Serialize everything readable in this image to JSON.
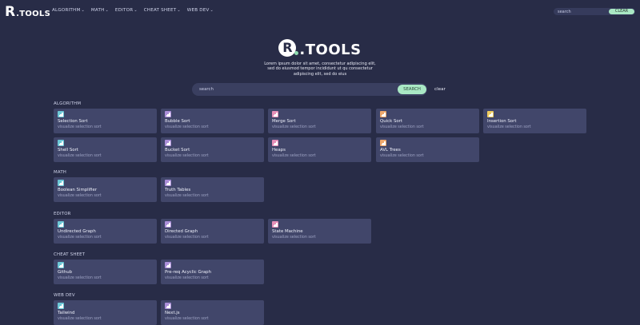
{
  "brand": {
    "logo_letter": "R",
    "logo_text": ".TOOLS"
  },
  "nav": {
    "items": [
      {
        "label": "ALGORITHM"
      },
      {
        "label": "MATH"
      },
      {
        "label": "EDITOR"
      },
      {
        "label": "CHEAT SHEET"
      },
      {
        "label": "WEB DEV"
      }
    ],
    "caret": "⌄",
    "search_placeholder": "search",
    "clear_label": "CLEAR"
  },
  "hero": {
    "description": "Lorem ipsum dolor sit amet, consectetur adipiscing elit, sed do eiusmod tempor incididunt ut qu consectetur adipiscing elit, sed do eius",
    "search_placeholder": "search",
    "search_button": "SEARCH",
    "clear_link": "clear"
  },
  "colors": {
    "background": "#282c47",
    "card": "#41466a",
    "accent": "#a9e8c4",
    "icon_teal": "#6cc7d6",
    "icon_pink": "#e58fb8",
    "icon_orange": "#eea76b",
    "icon_yellow": "#eecb5e",
    "icon_purple": "#ab8fd9"
  },
  "sections": [
    {
      "title": "ALGORITHM",
      "cards": [
        {
          "title": "Selection Sort",
          "subtitle": "visualize selection sort",
          "icon": "chart-bars-icon",
          "icon_color": "#6cc7d6"
        },
        {
          "title": "Bubble Sort",
          "subtitle": "visualize selection sort",
          "icon": "chart-bars-icon",
          "icon_color": "#ab8fd9"
        },
        {
          "title": "Merge Sort",
          "subtitle": "visualize selection sort",
          "icon": "chart-bars-icon",
          "icon_color": "#e58fb8"
        },
        {
          "title": "Quick Sort",
          "subtitle": "visualize selection sort",
          "icon": "chart-bars-icon",
          "icon_color": "#eea76b"
        },
        {
          "title": "Insertion Sort",
          "subtitle": "visualize selection sort",
          "icon": "chart-bars-icon",
          "icon_color": "#eecb5e"
        },
        {
          "title": "Shell Sort",
          "subtitle": "visualize selection sort",
          "icon": "chart-bars-icon",
          "icon_color": "#6cc7d6"
        },
        {
          "title": "Bucket Sort",
          "subtitle": "visualize selection sort",
          "icon": "chart-bars-icon",
          "icon_color": "#ab8fd9"
        },
        {
          "title": "Heaps",
          "subtitle": "visualize selection sort",
          "icon": "chart-bars-icon",
          "icon_color": "#e58fb8"
        },
        {
          "title": "AVL Trees",
          "subtitle": "visualize selection sort",
          "icon": "chart-bars-icon",
          "icon_color": "#eea76b"
        }
      ]
    },
    {
      "title": "MATH",
      "cards": [
        {
          "title": "Boolean Simplifier",
          "subtitle": "visualize selection sort",
          "icon": "chart-bars-icon",
          "icon_color": "#6cc7d6"
        },
        {
          "title": "Truth Tables",
          "subtitle": "visualize selection sort",
          "icon": "chart-bars-icon",
          "icon_color": "#ab8fd9"
        }
      ]
    },
    {
      "title": "EDITOR",
      "cards": [
        {
          "title": "Undirected Graph",
          "subtitle": "visualize selection sort",
          "icon": "chart-bars-icon",
          "icon_color": "#6cc7d6"
        },
        {
          "title": "Directed Graph",
          "subtitle": "visualize selection sort",
          "icon": "chart-bars-icon",
          "icon_color": "#ab8fd9"
        },
        {
          "title": "State Machine",
          "subtitle": "visualize selection sort",
          "icon": "chart-bars-icon",
          "icon_color": "#e58fb8"
        }
      ]
    },
    {
      "title": "CHEAT SHEET",
      "cards": [
        {
          "title": "Github",
          "subtitle": "visualize selection sort",
          "icon": "chart-bars-icon",
          "icon_color": "#6cc7d6"
        },
        {
          "title": "Pre-req Acyclic Graph",
          "subtitle": "visualize selection sort",
          "icon": "chart-bars-icon",
          "icon_color": "#ab8fd9"
        }
      ]
    },
    {
      "title": "WEB DEV",
      "cards": [
        {
          "title": "Tailwind",
          "subtitle": "visualize selection sort",
          "icon": "chart-bars-icon",
          "icon_color": "#6cc7d6"
        },
        {
          "title": "Next.js",
          "subtitle": "visualize selection sort",
          "icon": "chart-bars-icon",
          "icon_color": "#ab8fd9"
        }
      ]
    }
  ]
}
